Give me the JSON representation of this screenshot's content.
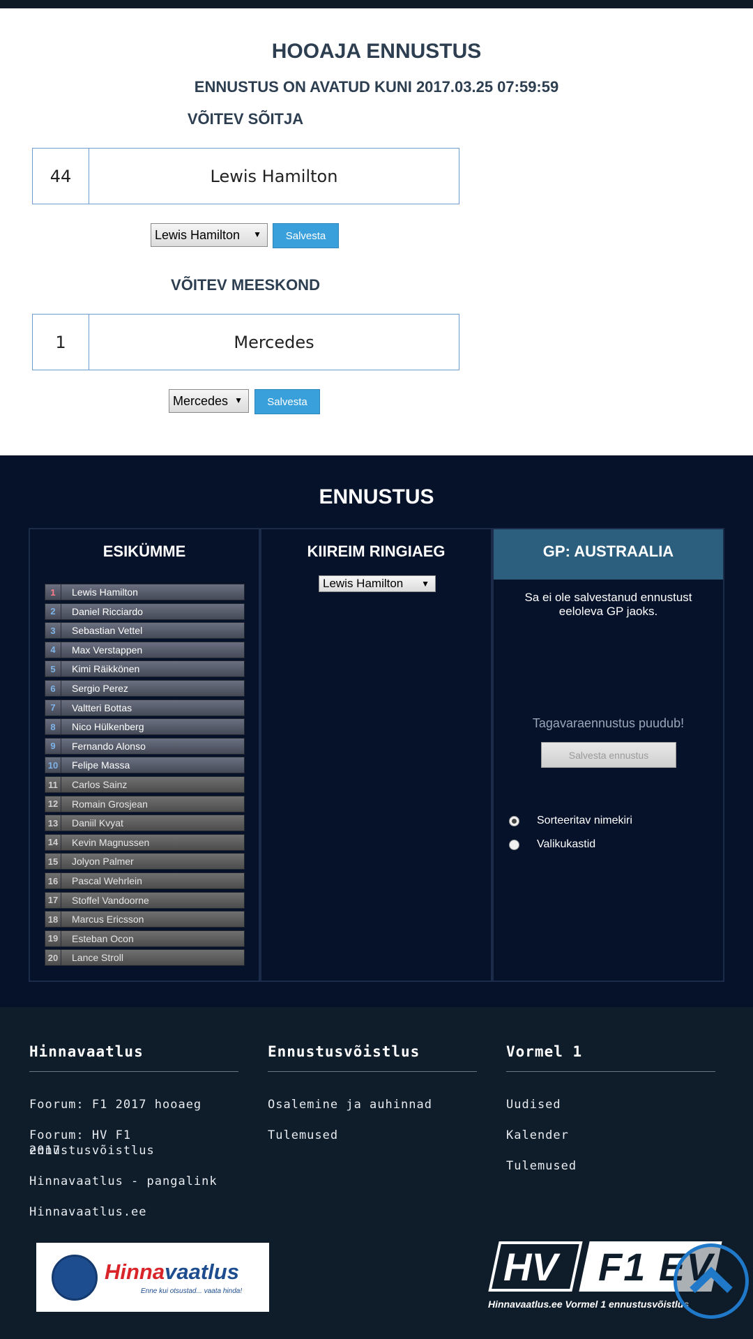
{
  "season": {
    "title": "HOOAJA ENNUSTUS",
    "deadline": "ENNUSTUS ON AVATUD KUNI 2017.03.25 07:59:59",
    "driver": {
      "heading": "VÕITEV SÕITJA",
      "number": "44",
      "name": "Lewis Hamilton",
      "select_value": "Lewis Hamilton",
      "save_label": "Salvesta"
    },
    "team": {
      "heading": "VÕITEV MEESKOND",
      "number": "1",
      "name": "Mercedes",
      "select_value": "Mercedes",
      "save_label": "Salvesta"
    }
  },
  "prediction": {
    "title": "ENNUSTUS",
    "top10": {
      "heading": "ESIKÜMME",
      "drivers": [
        {
          "pos": "1",
          "name": "Lewis Hamilton"
        },
        {
          "pos": "2",
          "name": "Daniel Ricciardo"
        },
        {
          "pos": "3",
          "name": "Sebastian Vettel"
        },
        {
          "pos": "4",
          "name": "Max Verstappen"
        },
        {
          "pos": "5",
          "name": "Kimi Räikkönen"
        },
        {
          "pos": "6",
          "name": "Sergio Perez"
        },
        {
          "pos": "7",
          "name": "Valtteri Bottas"
        },
        {
          "pos": "8",
          "name": "Nico Hülkenberg"
        },
        {
          "pos": "9",
          "name": "Fernando Alonso"
        },
        {
          "pos": "10",
          "name": "Felipe Massa"
        },
        {
          "pos": "11",
          "name": "Carlos Sainz"
        },
        {
          "pos": "12",
          "name": "Romain Grosjean"
        },
        {
          "pos": "13",
          "name": "Daniil Kvyat"
        },
        {
          "pos": "14",
          "name": "Kevin Magnussen"
        },
        {
          "pos": "15",
          "name": "Jolyon Palmer"
        },
        {
          "pos": "16",
          "name": "Pascal Wehrlein"
        },
        {
          "pos": "17",
          "name": "Stoffel Vandoorne"
        },
        {
          "pos": "18",
          "name": "Marcus Ericsson"
        },
        {
          "pos": "19",
          "name": "Esteban Ocon"
        },
        {
          "pos": "20",
          "name": "Lance Stroll"
        }
      ]
    },
    "fastest_lap": {
      "heading": "KIIREIM RINGIAEG",
      "select_value": "Lewis Hamilton"
    },
    "gp": {
      "heading": "GP: AUSTRAALIA",
      "not_saved_line1": "Sa ei ole salvestanud ennustust",
      "not_saved_line2": "eeloleva GP jaoks.",
      "backup_missing": "Tagavaraennustus puudub!",
      "save_label": "Salvesta ennustus",
      "radio_sortable": "Sorteeritav nimekiri",
      "radio_dropdowns": "Valikukastid"
    }
  },
  "footer": {
    "col1": {
      "heading": "Hinnavaatlus",
      "links": [
        "Foorum: F1 2017 hooaeg",
        "Foorum: HV F1 ennustusvõistlus",
        "2017",
        "Hinnavaatlus - pangalink",
        "Hinnavaatlus.ee"
      ]
    },
    "col2": {
      "heading": "Ennustusvõistlus",
      "links": [
        "Osalemine ja auhinnad",
        "Tulemused"
      ]
    },
    "col3": {
      "heading": "Vormel 1",
      "links": [
        "Uudised",
        "Kalender",
        "Tulemused"
      ]
    },
    "logo_hv": {
      "word_a": "Hinna",
      "word_b": "vaatlus",
      "tagline": "Enne kui otsustad... vaata hinda!"
    },
    "logo_f1": {
      "part1": "HV",
      "part2": "F1 EV",
      "subtitle": "Hinnavaatlus.ee Vormel 1 ennustusvõistlus"
    }
  }
}
